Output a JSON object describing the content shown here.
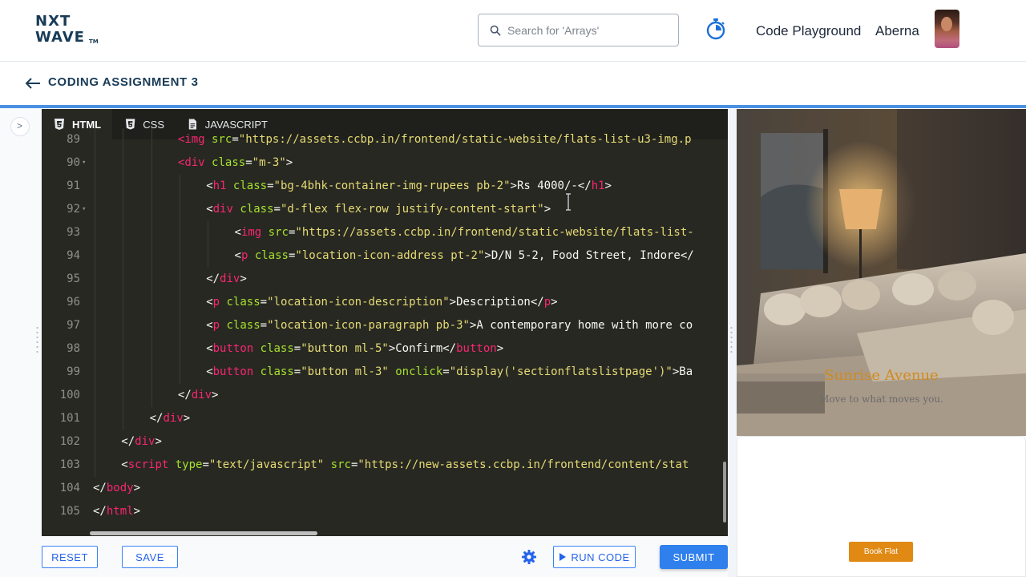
{
  "header": {
    "logo_line1": "NXT",
    "logo_line2": "WAVE",
    "logo_tm": "TM",
    "search_placeholder": "Search for 'Arrays'",
    "code_playground": "Code Playground",
    "username": "Aberna"
  },
  "assignment": {
    "title": "CODING ASSIGNMENT 3"
  },
  "editor": {
    "tabs": [
      {
        "label": "HTML",
        "icon": "html5-icon",
        "active": true
      },
      {
        "label": "CSS",
        "icon": "css3-icon",
        "active": false
      },
      {
        "label": "JAVASCRIPT",
        "icon": "js-file-icon",
        "active": false
      }
    ],
    "lines": [
      {
        "n": "89",
        "fold": false,
        "indent": 3,
        "tokens": [
          [
            "tag",
            "<img"
          ],
          [
            "txt",
            " "
          ],
          [
            "attr",
            "src"
          ],
          [
            "txt",
            "="
          ],
          [
            "str",
            "\"https://assets.ccbp.in/frontend/static-website/flats-list-u3-img.p"
          ]
        ]
      },
      {
        "n": "90",
        "fold": true,
        "indent": 3,
        "tokens": [
          [
            "tag",
            "<div"
          ],
          [
            "txt",
            " "
          ],
          [
            "attr",
            "class"
          ],
          [
            "txt",
            "="
          ],
          [
            "str",
            "\"m-3\""
          ],
          [
            "txt",
            ">"
          ]
        ]
      },
      {
        "n": "91",
        "fold": false,
        "indent": 4,
        "tokens": [
          [
            "txt",
            "<"
          ],
          [
            "tag",
            "h1"
          ],
          [
            "txt",
            " "
          ],
          [
            "attr",
            "class"
          ],
          [
            "txt",
            "="
          ],
          [
            "str",
            "\"bg-4bhk-container-img-rupees pb-2\""
          ],
          [
            "txt",
            ">Rs 4000/-</"
          ],
          [
            "tag",
            "h1"
          ],
          [
            "txt",
            ">"
          ]
        ]
      },
      {
        "n": "92",
        "fold": true,
        "indent": 4,
        "tokens": [
          [
            "txt",
            "<"
          ],
          [
            "tag",
            "div"
          ],
          [
            "txt",
            " "
          ],
          [
            "attr",
            "class"
          ],
          [
            "txt",
            "="
          ],
          [
            "str",
            "\"d-flex flex-row justify-content-start\""
          ],
          [
            "txt",
            ">"
          ]
        ]
      },
      {
        "n": "93",
        "fold": false,
        "indent": 5,
        "tokens": [
          [
            "txt",
            "<"
          ],
          [
            "tag",
            "img"
          ],
          [
            "txt",
            " "
          ],
          [
            "attr",
            "src"
          ],
          [
            "txt",
            "="
          ],
          [
            "str",
            "\"https://assets.ccbp.in/frontend/static-website/flats-list-"
          ]
        ]
      },
      {
        "n": "94",
        "fold": false,
        "indent": 5,
        "tokens": [
          [
            "txt",
            "<"
          ],
          [
            "tag",
            "p"
          ],
          [
            "txt",
            " "
          ],
          [
            "attr",
            "class"
          ],
          [
            "txt",
            "="
          ],
          [
            "str",
            "\"location-icon-address pt-2\""
          ],
          [
            "txt",
            ">D/N 5-2, Food Street, Indore</"
          ]
        ]
      },
      {
        "n": "95",
        "fold": false,
        "indent": 4,
        "tokens": [
          [
            "txt",
            "</"
          ],
          [
            "tag",
            "div"
          ],
          [
            "txt",
            ">"
          ]
        ]
      },
      {
        "n": "96",
        "fold": false,
        "indent": 4,
        "tokens": [
          [
            "txt",
            "<"
          ],
          [
            "tag",
            "p"
          ],
          [
            "txt",
            " "
          ],
          [
            "attr",
            "class"
          ],
          [
            "txt",
            "="
          ],
          [
            "str",
            "\"location-icon-description\""
          ],
          [
            "txt",
            ">Description</"
          ],
          [
            "tag",
            "p"
          ],
          [
            "txt",
            ">"
          ]
        ]
      },
      {
        "n": "97",
        "fold": false,
        "indent": 4,
        "tokens": [
          [
            "txt",
            "<"
          ],
          [
            "tag",
            "p"
          ],
          [
            "txt",
            " "
          ],
          [
            "attr",
            "class"
          ],
          [
            "txt",
            "="
          ],
          [
            "str",
            "\"location-icon-paragraph pb-3\""
          ],
          [
            "txt",
            ">A contemporary home with more co"
          ]
        ]
      },
      {
        "n": "98",
        "fold": false,
        "indent": 4,
        "tokens": [
          [
            "txt",
            "<"
          ],
          [
            "tag",
            "button"
          ],
          [
            "txt",
            " "
          ],
          [
            "attr",
            "class"
          ],
          [
            "txt",
            "="
          ],
          [
            "str",
            "\"button ml-5\""
          ],
          [
            "txt",
            ">Confirm</"
          ],
          [
            "tag",
            "button"
          ],
          [
            "txt",
            ">"
          ]
        ]
      },
      {
        "n": "99",
        "fold": false,
        "indent": 4,
        "tokens": [
          [
            "txt",
            "<"
          ],
          [
            "tag",
            "button"
          ],
          [
            "txt",
            " "
          ],
          [
            "attr",
            "class"
          ],
          [
            "txt",
            "="
          ],
          [
            "str",
            "\"button ml-3\""
          ],
          [
            "txt",
            " "
          ],
          [
            "attr",
            "onclick"
          ],
          [
            "txt",
            "="
          ],
          [
            "str",
            "\"display('sectionflatslistpage')\""
          ],
          [
            "txt",
            ">Ba"
          ]
        ]
      },
      {
        "n": "100",
        "fold": false,
        "indent": 3,
        "tokens": [
          [
            "txt",
            "</"
          ],
          [
            "tag",
            "div"
          ],
          [
            "txt",
            ">"
          ]
        ]
      },
      {
        "n": "101",
        "fold": false,
        "indent": 2,
        "tokens": [
          [
            "txt",
            "</"
          ],
          [
            "tag",
            "div"
          ],
          [
            "txt",
            ">"
          ]
        ]
      },
      {
        "n": "102",
        "fold": false,
        "indent": 1,
        "tokens": [
          [
            "txt",
            "</"
          ],
          [
            "tag",
            "div"
          ],
          [
            "txt",
            ">"
          ]
        ]
      },
      {
        "n": "103",
        "fold": false,
        "indent": 1,
        "tokens": [
          [
            "txt",
            "<"
          ],
          [
            "tag",
            "script"
          ],
          [
            "txt",
            " "
          ],
          [
            "attr",
            "type"
          ],
          [
            "txt",
            "="
          ],
          [
            "str",
            "\"text/javascript\""
          ],
          [
            "txt",
            " "
          ],
          [
            "attr",
            "src"
          ],
          [
            "txt",
            "="
          ],
          [
            "str",
            "\"https://new-assets.ccbp.in/frontend/content/stat"
          ]
        ]
      },
      {
        "n": "104",
        "fold": false,
        "indent": 0,
        "tokens": [
          [
            "txt",
            "</"
          ],
          [
            "tag",
            "body"
          ],
          [
            "txt",
            ">"
          ]
        ]
      },
      {
        "n": "105",
        "fold": false,
        "indent": 0,
        "tokens": [
          [
            "txt",
            "</"
          ],
          [
            "tag",
            "html"
          ],
          [
            "txt",
            ">"
          ]
        ]
      }
    ]
  },
  "actions": {
    "reset": "RESET",
    "save": "SAVE",
    "run_code": "RUN CODE",
    "submit": "SUBMIT"
  },
  "preview": {
    "title": "Sunrise Avenue",
    "subtitle": "Move to what moves you.",
    "button": "Book Flat"
  },
  "colors": {
    "brand": "#183b56",
    "accent": "#2f80ed",
    "editor_bg": "#272822",
    "preview_title": "#d08a1e",
    "preview_button": "#e08a14"
  }
}
